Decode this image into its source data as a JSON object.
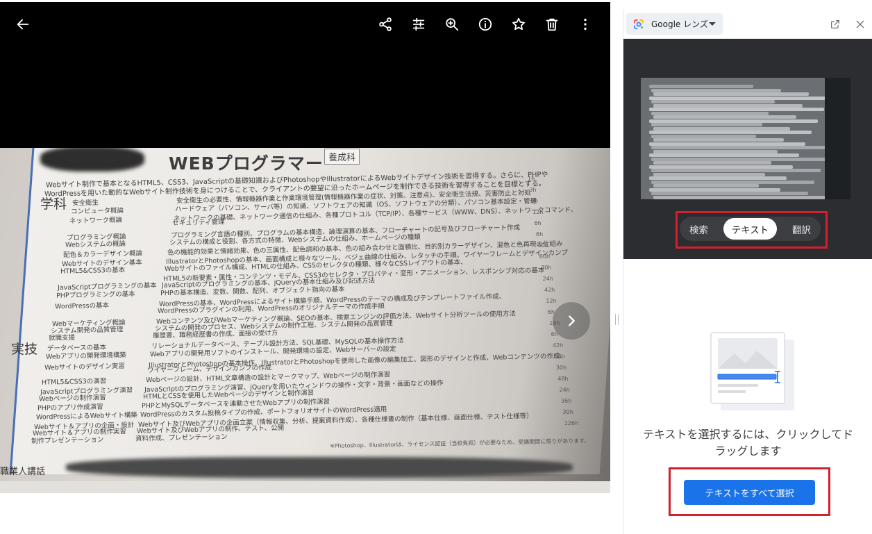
{
  "viewer": {
    "toolbar": [
      {
        "name": "back-arrow-icon"
      },
      {
        "name": "share-icon"
      },
      {
        "name": "adjust-sliders-icon"
      },
      {
        "name": "zoom-in-icon"
      },
      {
        "name": "info-icon"
      },
      {
        "name": "star-icon"
      },
      {
        "name": "trash-icon"
      },
      {
        "name": "more-vertical-icon"
      }
    ],
    "next_icon": "chevron-right-icon",
    "photo": {
      "title": "WEBプログラマー",
      "badge": "養成科",
      "intro_1": "Webサイト制作で基本となるHTML5、CSS3、JavaScriptの基礎知識およびPhotoshopやIllustratorによるWebサイトデザイン技術を習得する。さらに、PHPや",
      "intro_2": "WordPressを用いた動的なWebサイト制作技術を身につけることで、クライアントの要望に沿ったホームページを制作できる技術を習得することを目標とする。",
      "section_1": "学科",
      "section_2": "実技",
      "rows": [
        {
          "name": "安全衛生",
          "desc": "安全衛生の必要性、情報機器作業と作業環境管理(情報機器作業の症状、対策、注意点)、安全衛生法規、災害防止と対処"
        },
        {
          "name": "コンピュータ概論",
          "desc": "ハードウェア（パソコン、サーバ等）の知識、ソフトウェアの知識（OS、ソフトウェアの分類）、パソコン基本設定・管理"
        },
        {
          "name": "ネットワーク概論",
          "desc": "ネットワークの基礎、ネットワーク通信の仕組み、各種プロトコル（TCP/IP）、各種サービス（WWW、DNS）、ネットワークコマンド、"
        },
        {
          "name": "",
          "desc": "セキュリティ管理"
        },
        {
          "name": "プログラミング概論",
          "desc": "プログラミング言語の種別、プログラムの基本構造、論理演算の基本、フローチャートの記号及びフローチャート作成"
        },
        {
          "name": "Webシステムの概論",
          "desc": "システムの構成と役割、各方式の特徴、Webシステムの仕組み、ホームページの種類"
        },
        {
          "name": "配色＆カラーデザイン概論",
          "desc": "色の機能的効果と情緒効果、色の三属性、配色調和の基本、色の組み合わせと面積比、目的別カラーデザイン、混色と色再現の仕組み"
        },
        {
          "name": "Webサイトのデザイン基本",
          "desc": "IllustratorとPhotoshopの基本、画面構成と様々なツール、ベジェ曲線の仕組み、レタッチの手順、ワイヤーフレームとデザインカンプ"
        },
        {
          "name": "HTML5&CSS3の基本",
          "desc": "Webサイトのファイル構成、HTMLの仕組み、CSSのセレクタの種類、様々なCSSレイアウトの基本、"
        },
        {
          "name": "",
          "desc": "HTML5の新要素・属性・コンテンツ・モデル、CSS3のセレクタ・プロパティ・変形・アニメーション、レスポンシブ対応の基本"
        },
        {
          "name": "JavaScriptプログラミングの基本",
          "desc": "JavaScriptのプログラミングの基本、jQueryの基本仕組み及び記述方法"
        },
        {
          "name": "PHPプログラミングの基本",
          "desc": "PHPの基本構造、変数、関数、配列、オブジェクト指向の基本"
        },
        {
          "name": "WordPressの基本",
          "desc": "WordPressの基本、WordPressによるサイト構築手順、WordPressのテーマの構成及びテンプレートファイル作成、"
        },
        {
          "name": "",
          "desc": "WordPressのプラグインの利用、WordPressのオリジナルテーマの作成手順"
        },
        {
          "name": "Webマーケティング概論",
          "desc": "Webコンテンツ及びWebマーケティング概論、SEOの基本、検索エンジンの評価方法、Webサイト分析ツールの使用方法"
        },
        {
          "name": "システム開発の品質管理",
          "desc": "システムの開発のプロセス、Webシステムの制作工程、システム開発の品質管理"
        },
        {
          "name": "就職支援",
          "desc": "履歴書、職務経歴書の作成、面接の受け方"
        },
        {
          "name": "データベースの基本",
          "desc": "リレーショナルデータベース、テーブル設計方法、SQL基礎、MySQLの基本操作方法"
        },
        {
          "name": "Webアプリの開発環境構築",
          "desc": "Webアプリの開発用ソフトのインストール、開発環境の設定、Webサーバーの設定"
        },
        {
          "name": "Webサイトのデザイン実習",
          "desc": "IllustratorとPhotoshopの基本操作、IllustratorとPhotoshopを使用した画像の編集加工、図形のデザインと作成、Webコンテンツの作成、"
        },
        {
          "name": "",
          "desc": "ワイヤーフレーム、デザインカンプの作成"
        },
        {
          "name": "HTML5&CSS3の演習",
          "desc": "Webページの設計、HTML文章構造の設計とマークマップ、Webページの制作演習"
        },
        {
          "name": "JavaScriptプログラミング演習",
          "desc": "JavaScriptのプログラミング演習、jQueryを用いたウィンドウの操作・文字・背景・画面などの操作"
        },
        {
          "name": "Webページの制作演習",
          "desc": "HTMLとCSSを使用したWebページのデザインと制作演習"
        },
        {
          "name": "PHPのアプリ作成演習",
          "desc": "PHPとMySQLデータベースを連動させたWebアプリの制作演習"
        },
        {
          "name": "WordPressによるWebサイト構築",
          "desc": "WordPressのカスタム投稿タイプの作成、ポートフォリオサイトのWordPress適用"
        },
        {
          "name": "Webサイト＆アプリの企画・設計",
          "desc": "Webサイト及びWebアプリの企画立案（情報収集、分析、提案資料作成）、各種仕様書の制作（基本仕様、画面仕様、テスト仕様等）"
        },
        {
          "name": "Webサイト＆アプリの制作実習",
          "desc": "Webサイト及びWebアプリの制作、テスト、公開"
        },
        {
          "name": "制作プレゼンテーション",
          "desc": "資料作成、プレゼンテーション"
        }
      ],
      "hours": [
        "1h",
        "3h",
        "9h",
        "12h",
        "6h",
        "6h",
        "30h",
        "60h",
        "30h",
        "24h",
        "42h",
        "12h",
        "6h",
        "18h",
        "6h",
        "42h",
        "18h",
        "30h",
        "48h",
        "24h",
        "36h",
        "30h",
        "126h"
      ],
      "footnote": "※Photoshop、Illustratorは、ライセンス認証（当校負担）が必要なため、受講期間に限りがあります。",
      "bottom_label": "職業人講話"
    }
  },
  "lens": {
    "title": "Google レンズ",
    "logo_icon": "google-lens-icon",
    "open_icon": "open-in-new-icon",
    "close_icon": "close-icon",
    "modes": [
      "検索",
      "テキスト",
      "翻訳"
    ],
    "active_mode": "テキスト",
    "hint": "テキストを選択するには、クリックしてドラッグします",
    "select_all": "テキストをすべて選択"
  },
  "colors": {
    "accent": "#1a73e8",
    "highlight_frame": "#d4202c",
    "preview_bg": "#2b2d30",
    "viewer_bg": "#000000"
  }
}
